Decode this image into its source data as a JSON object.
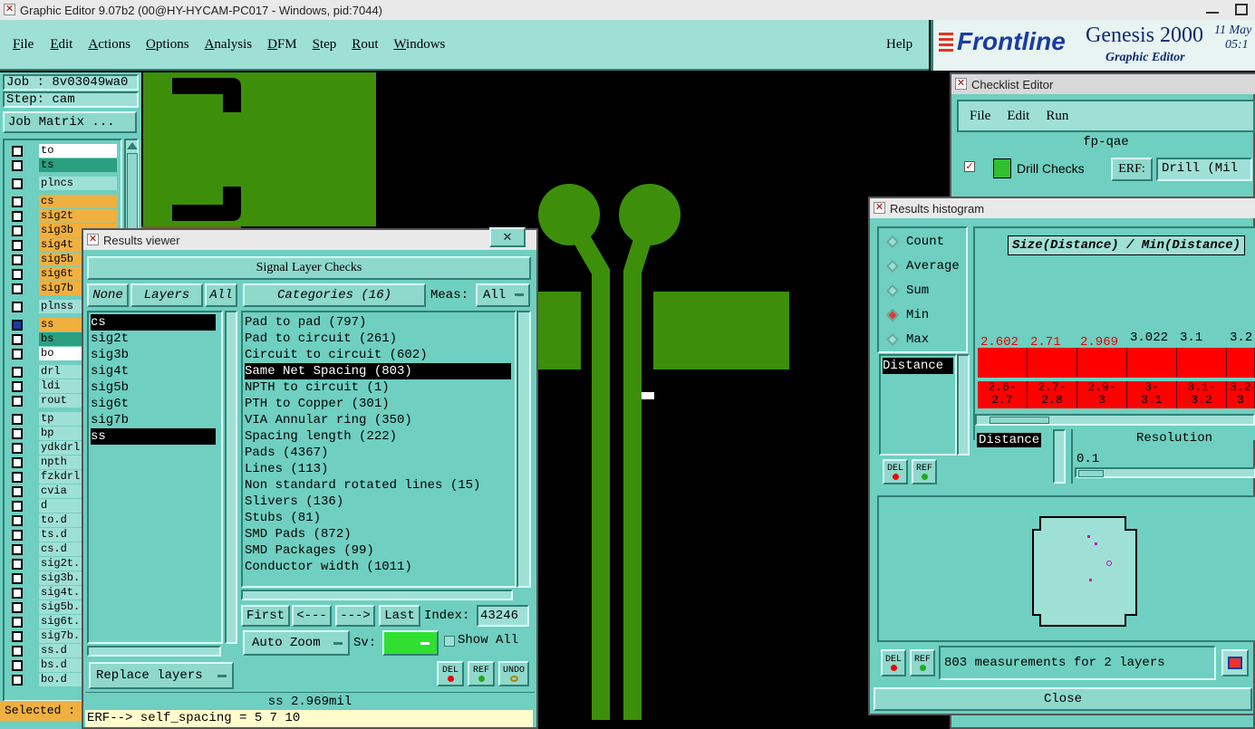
{
  "window": {
    "title": "Graphic Editor 9.07b2 (00@HY-HYCAM-PC017 - Windows, pid:7044)"
  },
  "menu": [
    "File",
    "Edit",
    "Actions",
    "Options",
    "Analysis",
    "DFM",
    "Step",
    "Rout",
    "Windows"
  ],
  "help": "Help",
  "brand": {
    "logo": "Frontline",
    "product": "Genesis 2000",
    "subtitle": "Graphic Editor",
    "date": "11 May",
    "time": "05:1"
  },
  "job": {
    "job": "Job : 8v03049wa0",
    "step": "Step: cam",
    "matrix_button": "Job Matrix ..."
  },
  "layers": [
    {
      "name": "to",
      "color": "#ffffff"
    },
    {
      "name": "ts",
      "color": "#2aa080"
    },
    {
      "name": "plncs",
      "color": "#9fe0d6"
    },
    {
      "name": "cs",
      "color": "#f0b040"
    },
    {
      "name": "sig2t",
      "color": "#f0b040"
    },
    {
      "name": "sig3b",
      "color": "#f0b040"
    },
    {
      "name": "sig4t",
      "color": "#f0b040"
    },
    {
      "name": "sig5b",
      "color": "#f0b040"
    },
    {
      "name": "sig6t",
      "color": "#f0b040"
    },
    {
      "name": "sig7b",
      "color": "#f0b040"
    },
    {
      "name": "plnss",
      "color": "#9fe0d6"
    },
    {
      "name": "ss",
      "color": "#f0b040"
    },
    {
      "name": "bs",
      "color": "#2aa080"
    },
    {
      "name": "bo",
      "color": "#ffffff"
    },
    {
      "name": "drl",
      "color": "#9fe0d6"
    },
    {
      "name": "ldi",
      "color": "#9fe0d6"
    },
    {
      "name": "rout",
      "color": "#9fe0d6"
    },
    {
      "name": "tp",
      "color": "#9fe0d6"
    },
    {
      "name": "bp",
      "color": "#9fe0d6"
    },
    {
      "name": "ydkdrl",
      "color": "#9fe0d6"
    },
    {
      "name": "npth",
      "color": "#9fe0d6"
    },
    {
      "name": "fzkdrl",
      "color": "#9fe0d6"
    },
    {
      "name": "cvia",
      "color": "#9fe0d6"
    },
    {
      "name": "d",
      "color": "#9fe0d6"
    },
    {
      "name": "to.d",
      "color": "#9fe0d6"
    },
    {
      "name": "ts.d",
      "color": "#9fe0d6"
    },
    {
      "name": "cs.d",
      "color": "#9fe0d6"
    },
    {
      "name": "sig2t.",
      "color": "#9fe0d6"
    },
    {
      "name": "sig3b.",
      "color": "#9fe0d6"
    },
    {
      "name": "sig4t.",
      "color": "#9fe0d6"
    },
    {
      "name": "sig5b.",
      "color": "#9fe0d6"
    },
    {
      "name": "sig6t.",
      "color": "#9fe0d6"
    },
    {
      "name": "sig7b.",
      "color": "#9fe0d6"
    },
    {
      "name": "ss.d",
      "color": "#9fe0d6"
    },
    {
      "name": "bs.d",
      "color": "#9fe0d6"
    },
    {
      "name": "bo.d",
      "color": "#9fe0d6"
    }
  ],
  "selected_label": "Selected :",
  "results_viewer": {
    "title": "Results viewer",
    "close": "✕",
    "header": "Signal Layer Checks",
    "none_btn": "None",
    "layers_btn": "Layers",
    "all_btn": "All",
    "categories_btn": "Categories (16)",
    "meas_label": "Meas:",
    "meas_value": "All",
    "layer_list": [
      "cs",
      "sig2t",
      "sig3b",
      "sig4t",
      "sig5b",
      "sig6t",
      "sig7b",
      "ss"
    ],
    "categories": [
      "Pad to pad (797)",
      "Pad to circuit (261)",
      "Circuit to circuit (602)",
      "Same Net Spacing (803)",
      "NPTH to circuit (1)",
      "PTH to Copper (301)",
      "VIA Annular ring (350)",
      "Spacing length (222)",
      "Pads (4367)",
      "Lines (113)",
      "Non standard rotated lines (15)",
      "Slivers (136)",
      "Stubs (81)",
      "SMD Pads (872)",
      "SMD Packages (99)",
      "Conductor width (1011)"
    ],
    "first": "First",
    "prev": "<---",
    "next": "--->",
    "last": "Last",
    "index_label": "Index:",
    "index_value": "43246",
    "auto_zoom": "Auto Zoom",
    "sv_label": "Sv:",
    "show_all": "Show All",
    "replace_layers": "Replace layers",
    "del": "DEL",
    "ref": "REF",
    "undo": "UNDO",
    "status": "ss 2.969mil",
    "erf": "ERF--> self_spacing = 5 7 10"
  },
  "checklist": {
    "title": "Checklist Editor",
    "menu": [
      "File",
      "Edit",
      "Run"
    ],
    "name": "fp-qae",
    "drill_checks": "Drill Checks",
    "erf_label": "ERF:",
    "erf_value": "Drill (Mil"
  },
  "histogram": {
    "title": "Results histogram",
    "modes": [
      "Count",
      "Average",
      "Sum",
      "Min",
      "Max"
    ],
    "selected_mode": "Min",
    "metric_list": [
      "Distance"
    ],
    "formula": "Size(Distance) / Min(Distance)",
    "x_label": "Distance",
    "resolution_label": "Resolution",
    "resolution_value": "0.1",
    "del": "DEL",
    "ref": "REF",
    "summary": "803 measurements for 2 layers",
    "close": "Close"
  },
  "chart_data": {
    "type": "bar",
    "categories": [
      "2.6-2.7",
      "2.7-2.8",
      "2.9-3",
      "3-3.1",
      "3.1-3.2",
      "3.2-3"
    ],
    "values": [
      2.602,
      2.71,
      2.969,
      3.022,
      3.1,
      3.2
    ],
    "value_labels": [
      "2.602",
      "2.71",
      "2.969",
      "3.022",
      "3.1",
      "3.2"
    ],
    "bin_labels": [
      [
        "2.6-",
        "2.7"
      ],
      [
        "2.7-",
        "2.8"
      ],
      [
        "2.9-",
        "3"
      ],
      [
        "3-",
        "3.1"
      ],
      [
        "3.1-",
        "3.2"
      ],
      [
        "3.2",
        "3"
      ]
    ],
    "red_labels": [
      true,
      true,
      true,
      false,
      false,
      false
    ],
    "title": "Size(Distance) / Min(Distance)",
    "xlabel": "Distance"
  },
  "colors": {
    "panel": "#6fcfc0",
    "copper": "#3d8f0a",
    "highlight": "#ff0000"
  }
}
